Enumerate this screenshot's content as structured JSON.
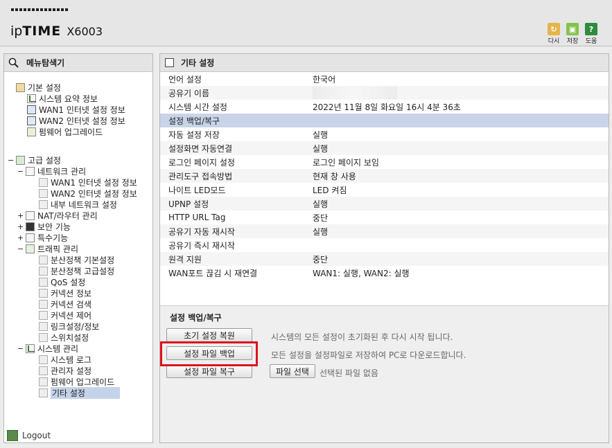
{
  "header": {
    "brand_prefix": "ip",
    "brand_main": "TIME",
    "model": "X6003",
    "buttons": [
      {
        "label": "다시",
        "icon": "refresh-icon",
        "color": "#e0b040"
      },
      {
        "label": "저장",
        "icon": "save-icon",
        "color": "#7cbf48"
      },
      {
        "label": "도움",
        "icon": "help-icon",
        "color": "#2e8b3e"
      }
    ]
  },
  "nav": {
    "title": "메뉴탐색기",
    "basic": {
      "label": "기본 설정",
      "items": [
        "시스템 요약 정보",
        "WAN1 인터넷 설정 정보",
        "WAN2 인터넷 설정 정보",
        "펌웨어 업그레이드"
      ]
    },
    "advanced": {
      "label": "고급 설정",
      "network": {
        "label": "네트워크 관리",
        "items": [
          "WAN1 인터넷 설정 정보",
          "WAN2 인터넷 설정 정보",
          "내부 네트워크 설정"
        ]
      },
      "nat": "NAT/라우터 관리",
      "security": "보안 기능",
      "special": "특수기능",
      "traffic": {
        "label": "트래픽 관리",
        "items": [
          "분산정책 기본설정",
          "분산정책 고급설정",
          "QoS 설정",
          "커넥션 정보",
          "커넥션 검색",
          "커넥션 제어",
          "링크설정/정보",
          "스위치설정"
        ]
      },
      "system": {
        "label": "시스템 관리",
        "items": [
          "시스템 로그",
          "관리자 설정",
          "펌웨어 업그레이드",
          "기타 설정"
        ]
      }
    },
    "logout": "Logout"
  },
  "main": {
    "title": "기타 설정",
    "rows": [
      {
        "key": "언어 설정",
        "value": "한국어"
      },
      {
        "key": "공유기 이름",
        "value": ""
      },
      {
        "key": "시스템 시간 설정",
        "value": "2022년 11월 8일 화요일 16시 4분 36초"
      },
      {
        "key": "설정 백업/복구",
        "value": ""
      },
      {
        "key": "자동 설정 저장",
        "value": "실행"
      },
      {
        "key": "설정화면 자동연결",
        "value": "실행"
      },
      {
        "key": "로그인 페이지 설정",
        "value": "로그인 페이지 보임"
      },
      {
        "key": "관리도구 접속방법",
        "value": "현재 창 사용"
      },
      {
        "key": "나이트 LED모드",
        "value": "LED 켜짐"
      },
      {
        "key": "UPNP 설정",
        "value": "실행"
      },
      {
        "key": "HTTP URL Tag",
        "value": "중단"
      },
      {
        "key": "공유기 자동 재시작",
        "value": "실행"
      },
      {
        "key": "공유기 즉시 재시작",
        "value": ""
      },
      {
        "key": "원격 지원",
        "value": "중단"
      },
      {
        "key": "WAN포트 끊김 시 재연결",
        "value": "WAN1: 실행, WAN2: 실행"
      }
    ],
    "backup": {
      "title": "설정 백업/복구",
      "reset_button": "초기 설정 복원",
      "reset_hint": "시스템의 모든 설정이 초기화된 후 다시 시작 됩니다.",
      "backup_button": "설정 파일 백업",
      "backup_hint": "모든 설정을 설정파일로 저장하여 PC로 다운로드합니다.",
      "restore_button": "설정 파일 복구",
      "file_button": "파일 선택",
      "file_status": "선택된 파일 없음"
    }
  }
}
